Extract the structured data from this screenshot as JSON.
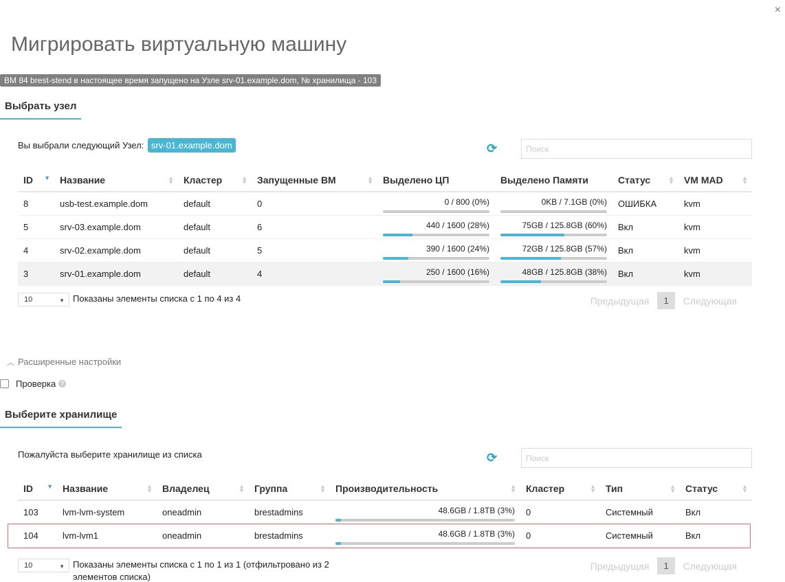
{
  "modal": {
    "title": "Мигрировать виртуальную машину",
    "close_label": "×",
    "info": "ВМ 84 brest-stend в настоящее время запущено на Узле srv-01.example.dom, № хранилища - 103"
  },
  "host_section": {
    "title": "Выбрать узел",
    "selected_prefix": "Вы выбрали следующий Узел:",
    "selected_value": "srv-01.example.dom",
    "search_placeholder": "Поиск",
    "columns": [
      "ID",
      "Название",
      "Кластер",
      "Запущенные ВМ",
      "Выделено ЦП",
      "Выделено Памяти",
      "Статус",
      "VM MAD"
    ],
    "rows": [
      {
        "id": "8",
        "name": "usb-test.example.dom",
        "cluster": "default",
        "vms": "0",
        "cpu": "0 / 800 (0%)",
        "cpu_pct": 0,
        "mem": "0KB / 7.1GB (0%)",
        "mem_pct": 0,
        "status": "ОШИБКА",
        "mad": "kvm"
      },
      {
        "id": "5",
        "name": "srv-03.example.dom",
        "cluster": "default",
        "vms": "6",
        "cpu": "440 / 1600 (28%)",
        "cpu_pct": 28,
        "mem": "75GB / 125.8GB (60%)",
        "mem_pct": 60,
        "status": "Вкл",
        "mad": "kvm"
      },
      {
        "id": "4",
        "name": "srv-02.example.dom",
        "cluster": "default",
        "vms": "5",
        "cpu": "390 / 1600 (24%)",
        "cpu_pct": 24,
        "mem": "72GB / 125.8GB (57%)",
        "mem_pct": 57,
        "status": "Вкл",
        "mad": "kvm"
      },
      {
        "id": "3",
        "name": "srv-01.example.dom",
        "cluster": "default",
        "vms": "4",
        "cpu": "250 / 1600 (16%)",
        "cpu_pct": 16,
        "mem": "48GB / 125.8GB (38%)",
        "mem_pct": 38,
        "status": "Вкл",
        "mad": "kvm"
      }
    ],
    "page_size": "10",
    "shown_text": "Показаны элементы списка с 1 по 4 из 4",
    "prev": "Предыдущая",
    "page": "1",
    "next": "Следующая"
  },
  "advanced": {
    "label": "Расширенные настройки",
    "check_label": "Проверка",
    "help_icon": "?"
  },
  "ds_section": {
    "title": "Выберите хранилище",
    "prompt": "Пожалуйста выберите хранилище из списка",
    "search_placeholder": "Поиск",
    "columns": [
      "ID",
      "Название",
      "Владелец",
      "Группа",
      "Производительность",
      "Кластер",
      "Тип",
      "Статус"
    ],
    "rows": [
      {
        "id": "103",
        "name": "lvm-lvm-system",
        "owner": "oneadmin",
        "group": "brestadmins",
        "cap": "48.6GB / 1.8TB (3%)",
        "cap_pct": 3,
        "cluster": "0",
        "type": "Системный",
        "status": "Вкл"
      },
      {
        "id": "104",
        "name": "lvm-lvm1",
        "owner": "oneadmin",
        "group": "brestadmins",
        "cap": "48.6GB / 1.8TB (3%)",
        "cap_pct": 3,
        "cluster": "0",
        "type": "Системный",
        "status": "Вкл"
      }
    ],
    "page_size": "10",
    "shown_text_1": "Показаны элементы списка с 1 по 1 из 1 (отфильтровано из 2",
    "shown_text_2": "элементов списка)",
    "prev": "Предыдущая",
    "page": "1",
    "next": "Следующая"
  },
  "colors": {
    "accent": "#4bb6d3",
    "selection": "#e06b6b"
  }
}
